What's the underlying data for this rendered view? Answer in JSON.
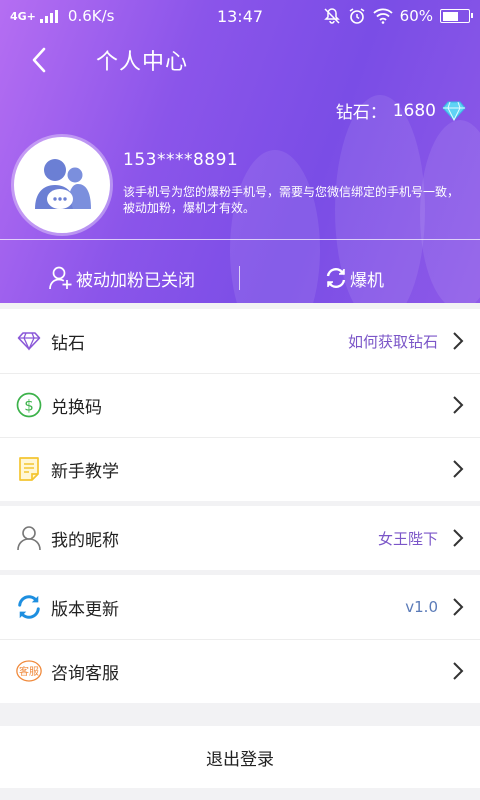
{
  "status_bar": {
    "network": "4G+",
    "speed": "0.6K/s",
    "time": "13:47",
    "battery": "60%",
    "battery_level": 0.6
  },
  "header": {
    "title": "个人中心"
  },
  "profile": {
    "diamond_label": "钻石：",
    "diamond_count": "1680",
    "phone": "153****8891",
    "description": "该手机号为您的爆粉手机号，需要与您微信绑定的手机号一致，被动加粉，爆机才有效。",
    "passive_add_status": "被动加粉已关闭",
    "boom_label": "爆机"
  },
  "menu": {
    "diamond": {
      "label": "钻石",
      "value": "如何获取钻石"
    },
    "redeem": {
      "label": "兑换码"
    },
    "tutorial": {
      "label": "新手教学"
    },
    "nickname": {
      "label": "我的昵称",
      "value": "女王陛下"
    },
    "version": {
      "label": "版本更新",
      "value": "v1.0"
    },
    "service": {
      "label": "咨询客服",
      "icon_text": "客服"
    }
  },
  "logout": {
    "label": "退出登录"
  },
  "colors": {
    "accent": "#8b55ea",
    "diamond_icon": "#5fd3f5",
    "redeem_icon": "#3cb24a",
    "tutorial_icon": "#f4c531",
    "update_icon": "#1e8fe0",
    "service_icon": "#f08a3c"
  }
}
